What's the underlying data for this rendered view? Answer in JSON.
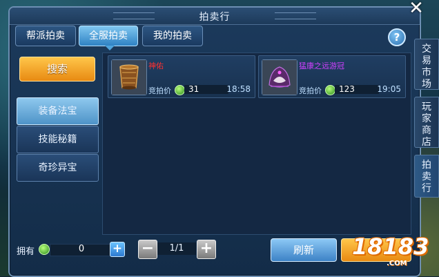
{
  "window": {
    "title": "拍卖行"
  },
  "tabs": [
    {
      "label": "帮派拍卖",
      "active": false
    },
    {
      "label": "全服拍卖",
      "active": true
    },
    {
      "label": "我的拍卖",
      "active": false
    }
  ],
  "help": {
    "label": "?"
  },
  "search": {
    "label": "搜索"
  },
  "categories": [
    {
      "label": "装备法宝",
      "active": true
    },
    {
      "label": "技能秘籍",
      "active": false
    },
    {
      "label": "奇珍异宝",
      "active": false
    }
  ],
  "items": [
    {
      "name": "神佑",
      "name_color": "#ff3030",
      "bid_label": "竞拍价",
      "price": "31",
      "time": "18:58",
      "icon": "bronze-cup-icon"
    },
    {
      "name": "猛康之远游冠",
      "name_color": "#d040ff",
      "bid_label": "竞拍价",
      "price": "123",
      "time": "19:05",
      "icon": "hood-crown-icon"
    }
  ],
  "footer": {
    "owned_label": "拥有",
    "owned_value": "0",
    "page_indicator": "1/1",
    "refresh_label": "刷新"
  },
  "side_tabs": [
    {
      "label": "交易市场",
      "active": false
    },
    {
      "label": "玩家商店",
      "active": false
    },
    {
      "label": "拍卖行",
      "active": true
    }
  ],
  "watermark": {
    "text": "18183",
    "sub": ".COM"
  },
  "close": {
    "label": "✕"
  }
}
